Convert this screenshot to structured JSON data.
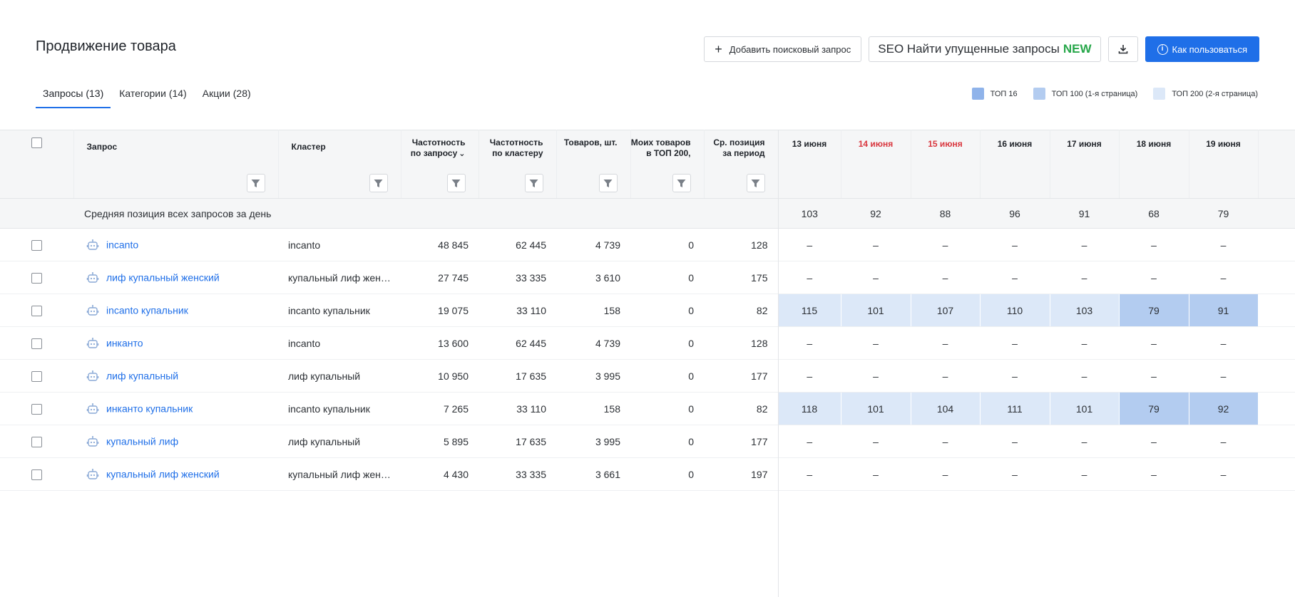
{
  "page": {
    "title": "Продвижение товара"
  },
  "toolbar": {
    "add_query_label": "Добавить поисковый запрос",
    "seo_label": "SEO Найти упущенные запросы",
    "seo_badge": "NEW",
    "download_icon": "download-icon",
    "help_label": "Как пользоваться"
  },
  "tabs": [
    {
      "label": "Запросы (13)",
      "active": true
    },
    {
      "label": "Категории (14)",
      "active": false
    },
    {
      "label": "Акции (28)",
      "active": false
    }
  ],
  "legend": [
    {
      "label": "ТОП 16",
      "color": "#8fb3ea"
    },
    {
      "label": "ТОП 100 (1-я страница)",
      "color": "#b3ccf0"
    },
    {
      "label": "ТОП 200 (2-я страница)",
      "color": "#dce8f8"
    }
  ],
  "table": {
    "columns": {
      "query": "Запрос",
      "cluster": "Кластер",
      "freq_query": "Частотность по запросу",
      "freq_cluster": "Частотность по кластеру",
      "goods": "Товаров, шт.",
      "my_goods": "Моих товаров в ТОП 200,",
      "avg_pos": "Ср. позиция за период"
    },
    "days": [
      {
        "label": "13 июня",
        "weekend": false
      },
      {
        "label": "14 июня",
        "weekend": true
      },
      {
        "label": "15 июня",
        "weekend": true
      },
      {
        "label": "16 июня",
        "weekend": false
      },
      {
        "label": "17 июня",
        "weekend": false
      },
      {
        "label": "18 июня",
        "weekend": false
      },
      {
        "label": "19 июня",
        "weekend": false
      }
    ],
    "avg_row": {
      "label": "Средняя позиция всех запросов за день",
      "values": [
        "103",
        "92",
        "88",
        "96",
        "91",
        "68",
        "79"
      ]
    },
    "rows": [
      {
        "query": "incanto",
        "cluster": "incanto",
        "freq_query": "48 845",
        "freq_cluster": "62 445",
        "goods": "4 739",
        "my_goods": "0",
        "avg_pos": "128",
        "days": [
          {
            "v": "–",
            "t": ""
          },
          {
            "v": "–",
            "t": ""
          },
          {
            "v": "–",
            "t": ""
          },
          {
            "v": "–",
            "t": ""
          },
          {
            "v": "–",
            "t": ""
          },
          {
            "v": "–",
            "t": ""
          },
          {
            "v": "–",
            "t": ""
          }
        ]
      },
      {
        "query": "лиф купальный женский",
        "cluster": "купальный лиф жен…",
        "freq_query": "27 745",
        "freq_cluster": "33 335",
        "goods": "3 610",
        "my_goods": "0",
        "avg_pos": "175",
        "days": [
          {
            "v": "–",
            "t": ""
          },
          {
            "v": "–",
            "t": ""
          },
          {
            "v": "–",
            "t": ""
          },
          {
            "v": "–",
            "t": ""
          },
          {
            "v": "–",
            "t": ""
          },
          {
            "v": "–",
            "t": ""
          },
          {
            "v": "–",
            "t": ""
          }
        ]
      },
      {
        "query": "incanto купальник",
        "cluster": "incanto купальник",
        "freq_query": "19 075",
        "freq_cluster": "33 110",
        "goods": "158",
        "my_goods": "0",
        "avg_pos": "82",
        "days": [
          {
            "v": "115",
            "t": "t200"
          },
          {
            "v": "101",
            "t": "t200"
          },
          {
            "v": "107",
            "t": "t200"
          },
          {
            "v": "110",
            "t": "t200"
          },
          {
            "v": "103",
            "t": "t200"
          },
          {
            "v": "79",
            "t": "t100"
          },
          {
            "v": "91",
            "t": "t100"
          }
        ]
      },
      {
        "query": "инканто",
        "cluster": "incanto",
        "freq_query": "13 600",
        "freq_cluster": "62 445",
        "goods": "4 739",
        "my_goods": "0",
        "avg_pos": "128",
        "days": [
          {
            "v": "–",
            "t": ""
          },
          {
            "v": "–",
            "t": ""
          },
          {
            "v": "–",
            "t": ""
          },
          {
            "v": "–",
            "t": ""
          },
          {
            "v": "–",
            "t": ""
          },
          {
            "v": "–",
            "t": ""
          },
          {
            "v": "–",
            "t": ""
          }
        ]
      },
      {
        "query": "лиф купальный",
        "cluster": "лиф купальный",
        "freq_query": "10 950",
        "freq_cluster": "17 635",
        "goods": "3 995",
        "my_goods": "0",
        "avg_pos": "177",
        "days": [
          {
            "v": "–",
            "t": ""
          },
          {
            "v": "–",
            "t": ""
          },
          {
            "v": "–",
            "t": ""
          },
          {
            "v": "–",
            "t": ""
          },
          {
            "v": "–",
            "t": ""
          },
          {
            "v": "–",
            "t": ""
          },
          {
            "v": "–",
            "t": ""
          }
        ]
      },
      {
        "query": "инканто купальник",
        "cluster": "incanto купальник",
        "freq_query": "7 265",
        "freq_cluster": "33 110",
        "goods": "158",
        "my_goods": "0",
        "avg_pos": "82",
        "days": [
          {
            "v": "118",
            "t": "t200"
          },
          {
            "v": "101",
            "t": "t200"
          },
          {
            "v": "104",
            "t": "t200"
          },
          {
            "v": "111",
            "t": "t200"
          },
          {
            "v": "101",
            "t": "t200"
          },
          {
            "v": "79",
            "t": "t100"
          },
          {
            "v": "92",
            "t": "t100"
          }
        ]
      },
      {
        "query": "купальный лиф",
        "cluster": "лиф купальный",
        "freq_query": "5 895",
        "freq_cluster": "17 635",
        "goods": "3 995",
        "my_goods": "0",
        "avg_pos": "177",
        "days": [
          {
            "v": "–",
            "t": ""
          },
          {
            "v": "–",
            "t": ""
          },
          {
            "v": "–",
            "t": ""
          },
          {
            "v": "–",
            "t": ""
          },
          {
            "v": "–",
            "t": ""
          },
          {
            "v": "–",
            "t": ""
          },
          {
            "v": "–",
            "t": ""
          }
        ]
      },
      {
        "query": "купальный лиф женский",
        "cluster": "купальный лиф жен…",
        "freq_query": "4 430",
        "freq_cluster": "33 335",
        "goods": "3 661",
        "my_goods": "0",
        "avg_pos": "197",
        "days": [
          {
            "v": "–",
            "t": ""
          },
          {
            "v": "–",
            "t": ""
          },
          {
            "v": "–",
            "t": ""
          },
          {
            "v": "–",
            "t": ""
          },
          {
            "v": "–",
            "t": ""
          },
          {
            "v": "–",
            "t": ""
          },
          {
            "v": "–",
            "t": ""
          }
        ]
      }
    ]
  }
}
